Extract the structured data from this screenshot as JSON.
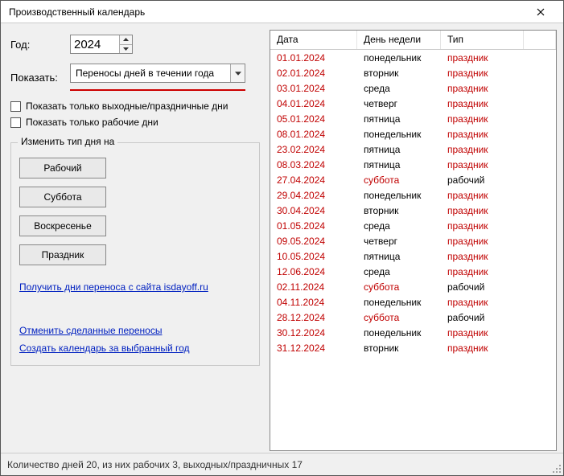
{
  "window": {
    "title": "Производственный календарь"
  },
  "left": {
    "year_label": "Год:",
    "year_value": "2024",
    "show_label": "Показать:",
    "show_value": "Переносы дней в течении года",
    "chk_weekends": "Показать только выходные/праздничные дни",
    "chk_workdays": "Показать только рабочие дни",
    "group_legend": "Изменить тип дня на",
    "btn_work": "Рабочий",
    "btn_sat": "Суббота",
    "btn_sun": "Воскресенье",
    "btn_holiday": "Праздник",
    "link_isdayoff": "Получить дни переноса с сайта isdayoff.ru",
    "link_cancel": "Отменить сделанные переносы",
    "link_create": "Создать календарь за выбранный год"
  },
  "table": {
    "headers": {
      "date": "Дата",
      "day": "День недели",
      "type": "Тип"
    },
    "rows": [
      {
        "date": "01.01.2024",
        "day": "понедельник",
        "type": "праздник",
        "date_red": true,
        "day_red": false,
        "type_red": true
      },
      {
        "date": "02.01.2024",
        "day": "вторник",
        "type": "праздник",
        "date_red": true,
        "day_red": false,
        "type_red": true
      },
      {
        "date": "03.01.2024",
        "day": "среда",
        "type": "праздник",
        "date_red": true,
        "day_red": false,
        "type_red": true
      },
      {
        "date": "04.01.2024",
        "day": "четверг",
        "type": "праздник",
        "date_red": true,
        "day_red": false,
        "type_red": true
      },
      {
        "date": "05.01.2024",
        "day": "пятница",
        "type": "праздник",
        "date_red": true,
        "day_red": false,
        "type_red": true
      },
      {
        "date": "08.01.2024",
        "day": "понедельник",
        "type": "праздник",
        "date_red": true,
        "day_red": false,
        "type_red": true
      },
      {
        "date": "23.02.2024",
        "day": "пятница",
        "type": "праздник",
        "date_red": true,
        "day_red": false,
        "type_red": true
      },
      {
        "date": "08.03.2024",
        "day": "пятница",
        "type": "праздник",
        "date_red": true,
        "day_red": false,
        "type_red": true
      },
      {
        "date": "27.04.2024",
        "day": "суббота",
        "type": "рабочий",
        "date_red": true,
        "day_red": true,
        "type_red": false
      },
      {
        "date": "29.04.2024",
        "day": "понедельник",
        "type": "праздник",
        "date_red": true,
        "day_red": false,
        "type_red": true
      },
      {
        "date": "30.04.2024",
        "day": "вторник",
        "type": "праздник",
        "date_red": true,
        "day_red": false,
        "type_red": true
      },
      {
        "date": "01.05.2024",
        "day": "среда",
        "type": "праздник",
        "date_red": true,
        "day_red": false,
        "type_red": true
      },
      {
        "date": "09.05.2024",
        "day": "четверг",
        "type": "праздник",
        "date_red": true,
        "day_red": false,
        "type_red": true
      },
      {
        "date": "10.05.2024",
        "day": "пятница",
        "type": "праздник",
        "date_red": true,
        "day_red": false,
        "type_red": true
      },
      {
        "date": "12.06.2024",
        "day": "среда",
        "type": "праздник",
        "date_red": true,
        "day_red": false,
        "type_red": true
      },
      {
        "date": "02.11.2024",
        "day": "суббота",
        "type": "рабочий",
        "date_red": true,
        "day_red": true,
        "type_red": false
      },
      {
        "date": "04.11.2024",
        "day": "понедельник",
        "type": "праздник",
        "date_red": true,
        "day_red": false,
        "type_red": true
      },
      {
        "date": "28.12.2024",
        "day": "суббота",
        "type": "рабочий",
        "date_red": true,
        "day_red": true,
        "type_red": false
      },
      {
        "date": "30.12.2024",
        "day": "понедельник",
        "type": "праздник",
        "date_red": true,
        "day_red": false,
        "type_red": true
      },
      {
        "date": "31.12.2024",
        "day": "вторник",
        "type": "праздник",
        "date_red": true,
        "day_red": false,
        "type_red": true
      }
    ]
  },
  "status": "Количество дней 20, из них рабочих 3, выходных/праздничных 17"
}
